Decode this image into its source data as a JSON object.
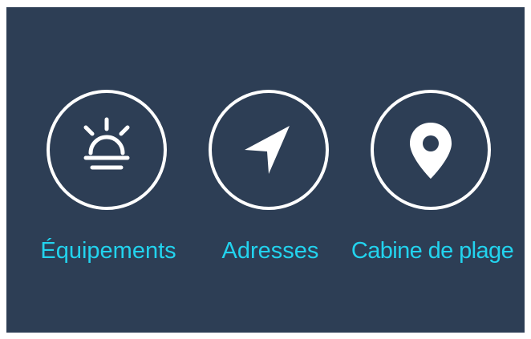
{
  "colors": {
    "background": "#2d3e55",
    "icon": "#ffffff",
    "label": "#22d3ee"
  },
  "menu": {
    "items": [
      {
        "label": "Équipements",
        "icon": "siren-icon"
      },
      {
        "label": "Adresses",
        "icon": "navigation-arrow-icon"
      },
      {
        "label": "Cabine de plage",
        "icon": "map-pin-icon"
      }
    ]
  }
}
